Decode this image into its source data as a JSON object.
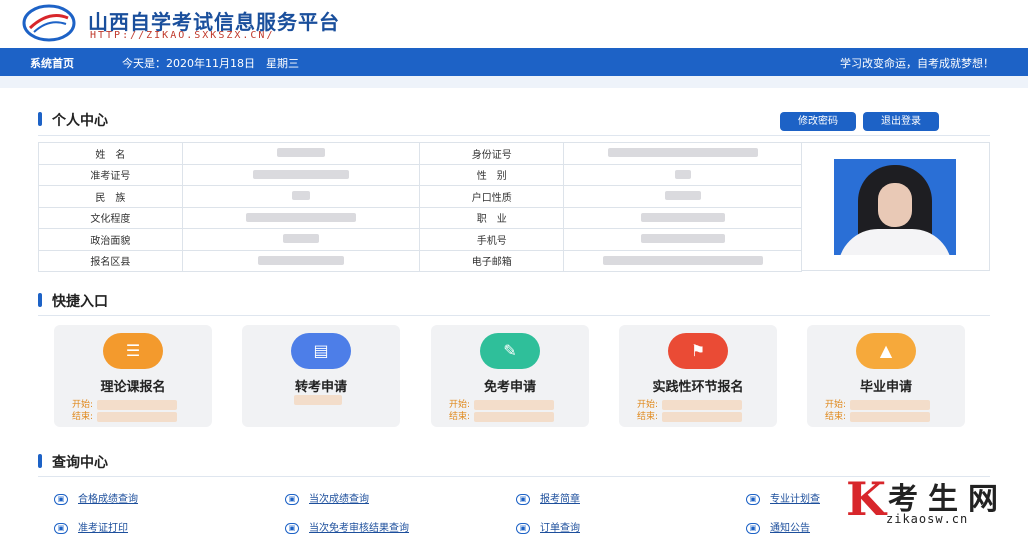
{
  "header": {
    "title": "山西自学考试信息服务平台",
    "url": "HTTP://ZIKAO.SXKSZX.CN/"
  },
  "navbar": {
    "home": "系统首页",
    "today": "今天是：2020年11月18日　星期三",
    "slogan": "学习改变命运，自考成就梦想！"
  },
  "personal": {
    "title": "个人中心",
    "change_password": "修改密码",
    "logout": "退出登录",
    "rows": [
      {
        "l1": "姓　名",
        "l2": "身份证号"
      },
      {
        "l1": "准考证号",
        "l2": "性　别"
      },
      {
        "l1": "民　族",
        "l2": "户口性质"
      },
      {
        "l1": "文化程度",
        "l2": "职　业"
      },
      {
        "l1": "政治面貌",
        "l2": "手机号"
      },
      {
        "l1": "报名区县",
        "l2": "电子邮箱"
      }
    ]
  },
  "quick": {
    "title": "快捷入口",
    "start_label": "开始:",
    "end_label": "结束:",
    "cards": [
      {
        "title": "理论课报名",
        "color": "#f39a2d",
        "icon": "stack-icon"
      },
      {
        "title": "转考申请",
        "color": "#4d7ee8",
        "icon": "document-icon"
      },
      {
        "title": "免考申请",
        "color": "#2fbf9a",
        "icon": "edit-icon"
      },
      {
        "title": "实践性环节报名",
        "color": "#ea4b35",
        "icon": "flag-icon"
      },
      {
        "title": "毕业申请",
        "color": "#f6a93b",
        "icon": "graduation-cap-icon"
      }
    ]
  },
  "query": {
    "title": "查询中心",
    "links": [
      "合格成绩查询",
      "当次成绩查询",
      "报考简章",
      "专业计划查",
      "准考证打印",
      "当次免考审核结果查询",
      "订单查询",
      "通知公告"
    ]
  },
  "watermark": {
    "letter": "K",
    "text": "考生网",
    "domain": "zikaosw.cn"
  }
}
